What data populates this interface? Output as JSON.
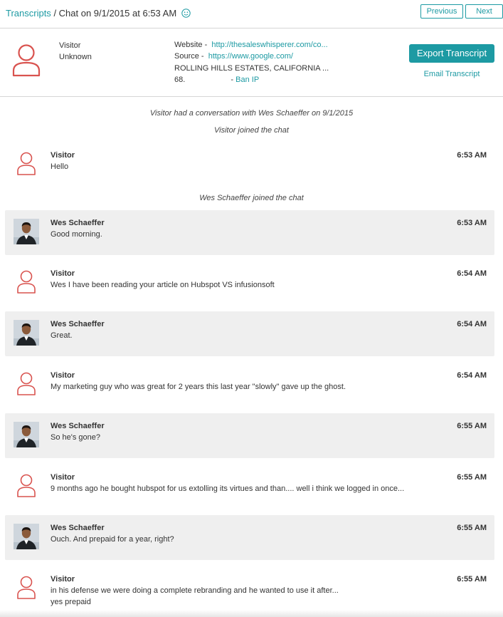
{
  "nav": {
    "transcripts_link": "Transcripts",
    "title": "/ Chat on 9/1/2015 at 6:53 AM",
    "previous": "Previous",
    "next": "Next"
  },
  "visitor": {
    "name": "Visitor",
    "status": "Unknown",
    "website_label": "Website -",
    "website_url": "http://thesaleswhisperer.com/co...",
    "source_label": "Source -",
    "source_url": "https://www.google.com/",
    "location": "ROLLING HILLS ESTATES, CALIFORNIA ...",
    "ip_partial": "68.",
    "ban_separator": "-",
    "ban_ip": "Ban IP"
  },
  "actions": {
    "export": "Export Transcript",
    "email": "Email Transcript"
  },
  "system_messages": [
    "Visitor had a conversation with Wes Schaeffer on 9/1/2015",
    "Visitor joined the chat",
    "Wes Schaeffer joined the chat"
  ],
  "messages": [
    {
      "role": "visitor",
      "author": "Visitor",
      "time": "6:53 AM",
      "text": "Hello",
      "text2": ""
    },
    {
      "role": "agent",
      "author": "Wes Schaeffer",
      "time": "6:53 AM",
      "text": "Good morning.",
      "text2": ""
    },
    {
      "role": "visitor",
      "author": "Visitor",
      "time": "6:54 AM",
      "text": "Wes I have been reading your article on Hubspot VS infusionsoft",
      "text2": ""
    },
    {
      "role": "agent",
      "author": "Wes Schaeffer",
      "time": "6:54 AM",
      "text": "Great.",
      "text2": ""
    },
    {
      "role": "visitor",
      "author": "Visitor",
      "time": "6:54 AM",
      "text": "My marketing guy who was great for 2 years this last year \"slowly\" gave up the ghost.",
      "text2": ""
    },
    {
      "role": "agent",
      "author": "Wes Schaeffer",
      "time": "6:55 AM",
      "text": "So he's gone?",
      "text2": ""
    },
    {
      "role": "visitor",
      "author": "Visitor",
      "time": "6:55 AM",
      "text": "9 months ago he bought hubspot for us extolling its virtues and than.... well i think we logged in once...",
      "text2": ""
    },
    {
      "role": "agent",
      "author": "Wes Schaeffer",
      "time": "6:55 AM",
      "text": "Ouch. And prepaid for a year, right?",
      "text2": ""
    },
    {
      "role": "visitor",
      "author": "Visitor",
      "time": "6:55 AM",
      "text": "in his defense we were doing a complete rebranding and he wanted to use it after...",
      "text2": "yes prepaid"
    }
  ],
  "colors": {
    "accent": "#1d9aa3",
    "visitor_icon": "#d9534f",
    "agent_bubble": "#efefef"
  },
  "icons": {
    "smiley": "smiley-icon",
    "visitor": "user-icon",
    "agent": "agent-photo"
  }
}
